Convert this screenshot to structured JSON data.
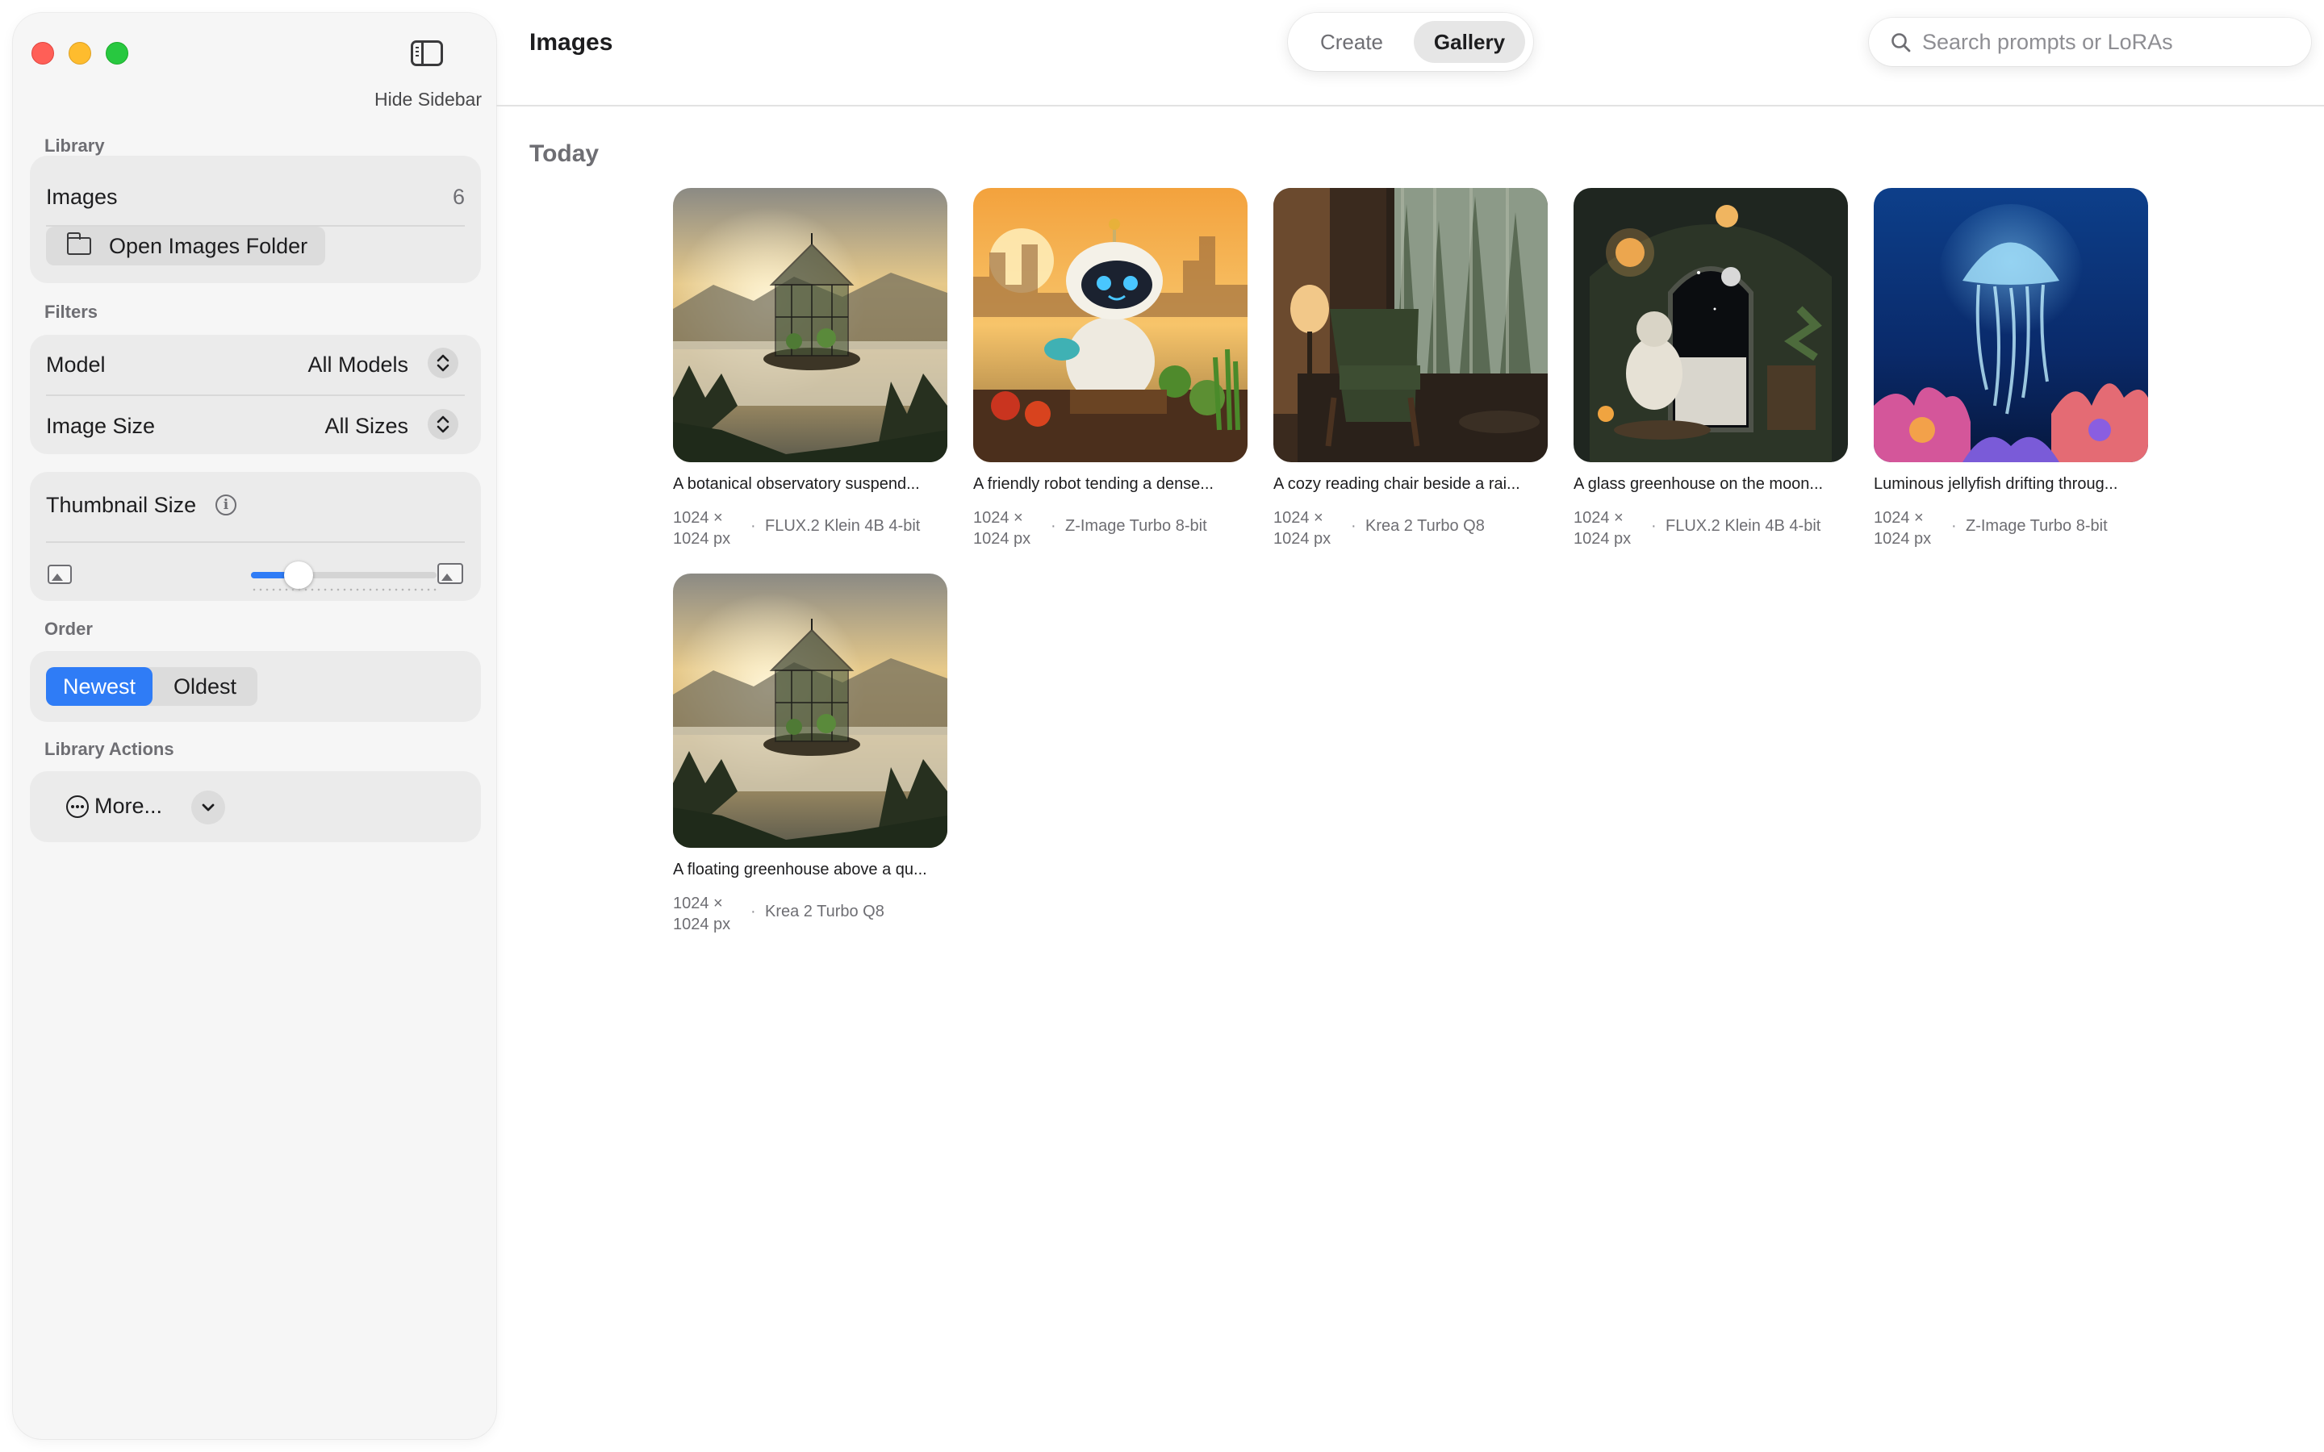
{
  "window": {
    "controls": [
      "close",
      "minimize",
      "zoom"
    ]
  },
  "sidebar": {
    "hide_label": "Hide Sidebar",
    "library": {
      "section_label": "Library",
      "images_label": "Images",
      "images_count": "6",
      "open_folder_label": "Open Images Folder"
    },
    "filters": {
      "section_label": "Filters",
      "model_label": "Model",
      "model_value": "All Models",
      "size_label": "Image Size",
      "size_value": "All Sizes"
    },
    "thumbnail": {
      "label": "Thumbnail Size",
      "slider_value_fraction": 0.18
    },
    "order": {
      "section_label": "Order",
      "options": [
        "Newest",
        "Oldest"
      ],
      "selected": "Newest"
    },
    "actions": {
      "section_label": "Library Actions",
      "more_label": "More..."
    }
  },
  "toolbar": {
    "title": "Images",
    "tabs": [
      "Create",
      "Gallery"
    ],
    "selected_tab": "Gallery",
    "search_placeholder": "Search prompts or LoRAs"
  },
  "gallery": {
    "section_title": "Today",
    "items": [
      {
        "caption": "A botanical observatory suspend...",
        "size": "1024 × 1024 px",
        "size_line1": "1024 ×",
        "size_line2": "1024 px",
        "model": "FLUX.2 Klein 4B 4-bit",
        "scene": "greenhouse"
      },
      {
        "caption": "A friendly robot tending a dense...",
        "size": "1024 × 1024 px",
        "size_line1": "1024 ×",
        "size_line2": "1024 px",
        "model": "Z-Image Turbo 8-bit",
        "scene": "robot"
      },
      {
        "caption": "A cozy reading chair beside a rai...",
        "size": "1024 × 1024 px",
        "size_line1": "1024 ×",
        "size_line2": "1024 px",
        "model": "Krea 2 Turbo Q8",
        "scene": "chair"
      },
      {
        "caption": "A glass greenhouse on the moon...",
        "size": "1024 × 1024 px",
        "size_line1": "1024 ×",
        "size_line2": "1024 px",
        "model": "FLUX.2 Klein 4B 4-bit",
        "scene": "moon"
      },
      {
        "caption": "Luminous jellyfish drifting throug...",
        "size": "1024 × 1024 px",
        "size_line1": "1024 ×",
        "size_line2": "1024 px",
        "model": "Z-Image Turbo 8-bit",
        "scene": "jellyfish"
      },
      {
        "caption": "A floating greenhouse above a qu...",
        "size": "1024 × 1024 px",
        "size_line1": "1024 ×",
        "size_line2": "1024 px",
        "model": "Krea 2 Turbo Q8",
        "scene": "greenhouse"
      }
    ]
  },
  "colors": {
    "accent": "#2f7cf6",
    "sidebar_bg": "#f6f6f6",
    "group_bg": "#ebebeb"
  }
}
